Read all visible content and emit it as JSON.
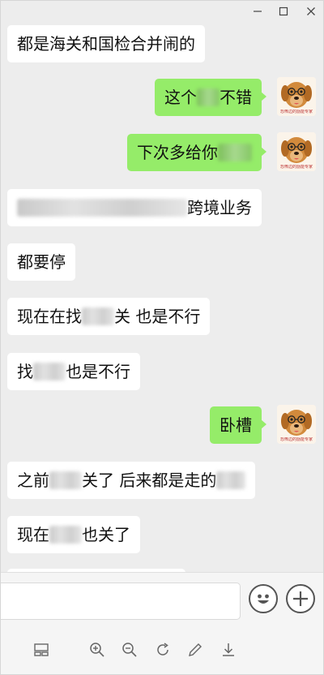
{
  "window": {
    "controls": {
      "minimize": "—",
      "maximize": "□",
      "close": "✕"
    }
  },
  "messages": [
    {
      "id": "m1",
      "side": "in",
      "parts": [
        {
          "t": "text",
          "v": "都是海关和国检合并闹的"
        }
      ]
    },
    {
      "id": "m2",
      "side": "out",
      "parts": [
        {
          "t": "text",
          "v": "这个"
        },
        {
          "t": "blur",
          "w": 28
        },
        {
          "t": "text",
          "v": "不错"
        }
      ],
      "avatar": "dog-avatar",
      "sticker_text": "恐怖边的励能专家"
    },
    {
      "id": "m3",
      "side": "out",
      "parts": [
        {
          "t": "text",
          "v": "下次多给你"
        },
        {
          "t": "blur",
          "w": 42
        }
      ],
      "avatar": "dog-avatar",
      "sticker_text": "恐怖边的励能专家"
    },
    {
      "id": "m4",
      "side": "in",
      "parts": [
        {
          "t": "blur",
          "w": 210
        },
        {
          "t": "text",
          "v": "跨境业务"
        }
      ]
    },
    {
      "id": "m5",
      "side": "in",
      "parts": [
        {
          "t": "text",
          "v": "都要停"
        }
      ]
    },
    {
      "id": "m6",
      "side": "in",
      "parts": [
        {
          "t": "text",
          "v": "现在在找"
        },
        {
          "t": "blur",
          "w": 40
        },
        {
          "t": "text",
          "v": "关 也是不行"
        }
      ]
    },
    {
      "id": "m7",
      "side": "in",
      "parts": [
        {
          "t": "text",
          "v": "找"
        },
        {
          "t": "blur",
          "w": 40
        },
        {
          "t": "text",
          "v": "也是不行"
        }
      ]
    },
    {
      "id": "m8",
      "side": "out",
      "parts": [
        {
          "t": "text",
          "v": "卧槽"
        }
      ],
      "avatar": "dog-avatar",
      "sticker_text": "恐怖边的励能专家"
    },
    {
      "id": "m9",
      "side": "in",
      "parts": [
        {
          "t": "text",
          "v": "之前"
        },
        {
          "t": "blur",
          "w": 40
        },
        {
          "t": "text",
          "v": "关了 后来都是走的"
        },
        {
          "t": "blur",
          "w": 36
        }
      ]
    },
    {
      "id": "m10",
      "side": "in",
      "parts": [
        {
          "t": "text",
          "v": "现在"
        },
        {
          "t": "blur",
          "w": 40
        },
        {
          "t": "text",
          "v": "也关了"
        }
      ]
    }
  ],
  "input": {
    "value": "",
    "placeholder": ""
  },
  "toolbar": {
    "icons": [
      "layout-icon",
      "zoom-in-icon",
      "zoom-out-icon",
      "rotate-icon",
      "edit-icon",
      "download-icon"
    ]
  },
  "colors": {
    "incoming": "#ffffff",
    "outgoing": "#95ec69",
    "background": "#ededed"
  }
}
